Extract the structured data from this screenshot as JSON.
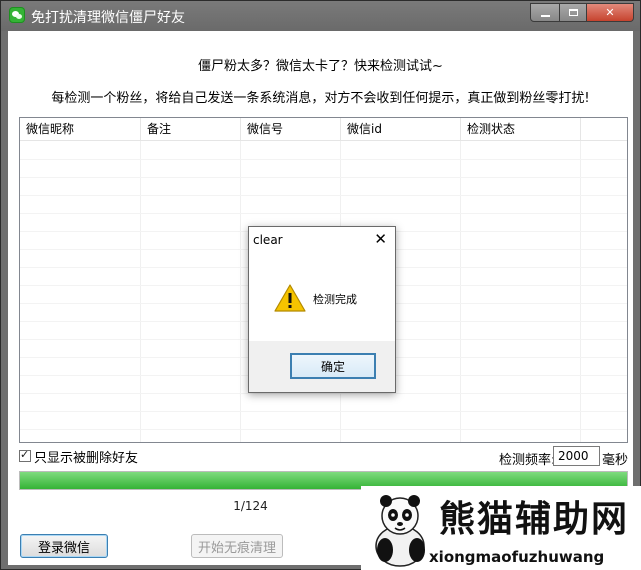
{
  "window": {
    "title": "免打扰清理微信僵尸好友"
  },
  "intro": {
    "line1": "僵尸粉太多？微信太卡了？快来检测试试~",
    "line2": "每检测一个粉丝，将给自己发送一条系统消息，对方不会收到任何提示，真正做到粉丝零打扰!"
  },
  "table": {
    "columns": [
      "微信昵称",
      "备注",
      "微信号",
      "微信id",
      "检测状态"
    ],
    "rows": []
  },
  "options": {
    "show_deleted_only_label": "只显示被删除好友",
    "show_deleted_only_checked": true,
    "frequency_label": "检测频率:",
    "frequency_value": "2000",
    "frequency_unit": "毫秒"
  },
  "progress": {
    "fraction": 1.0,
    "counter_text": "1/124"
  },
  "buttons": {
    "login_label": "登录微信",
    "clean_label": "开始无痕清理"
  },
  "dialog": {
    "title": "clear",
    "close_glyph": "✕",
    "message": "检测完成",
    "ok_label": "确定"
  },
  "watermark": {
    "brand_cn": "熊猫辅助网",
    "brand_en": "xiongmaofuzhuwang"
  },
  "colors": {
    "titlebar": "#6f6f6f",
    "progress_fill": "#35b336",
    "warning": "#f5c400",
    "focus_blue": "#3c7fb1"
  }
}
